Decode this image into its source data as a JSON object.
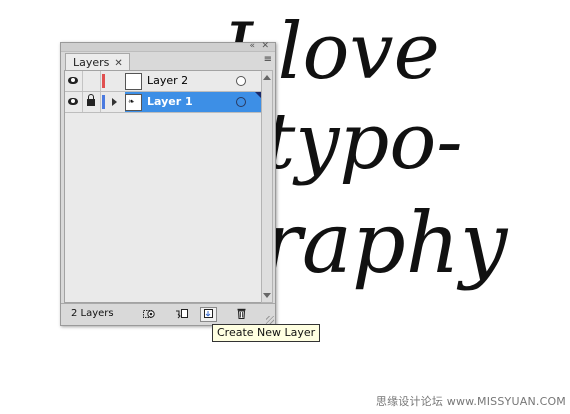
{
  "artwork": {
    "lines": [
      "I love",
      "typo-",
      "graphy"
    ]
  },
  "layers_panel": {
    "tab_label": "Layers",
    "tab_close": "✕",
    "menu_icon": "≡",
    "collapse_icon": "«",
    "close_icon": "✕",
    "layers": [
      {
        "name": "Layer 2",
        "visible": true,
        "locked": false,
        "color": "#e05050",
        "selected": false,
        "expandable": false
      },
      {
        "name": "Layer 1",
        "visible": true,
        "locked": true,
        "color": "#4a7ae0",
        "selected": true,
        "expandable": true
      }
    ],
    "layer_count": "2 Layers",
    "footer_buttons": [
      "make-clipping-mask",
      "create-new-sublayer",
      "create-new-layer",
      "delete-layer"
    ]
  },
  "tooltip": "Create New Layer",
  "watermark": "思缘设计论坛 www.MISSYUAN.COM",
  "colors": {
    "selection": "#3d8fe6",
    "panel_bg": "#d9d9d9",
    "tooltip_bg": "#ffffe1"
  }
}
